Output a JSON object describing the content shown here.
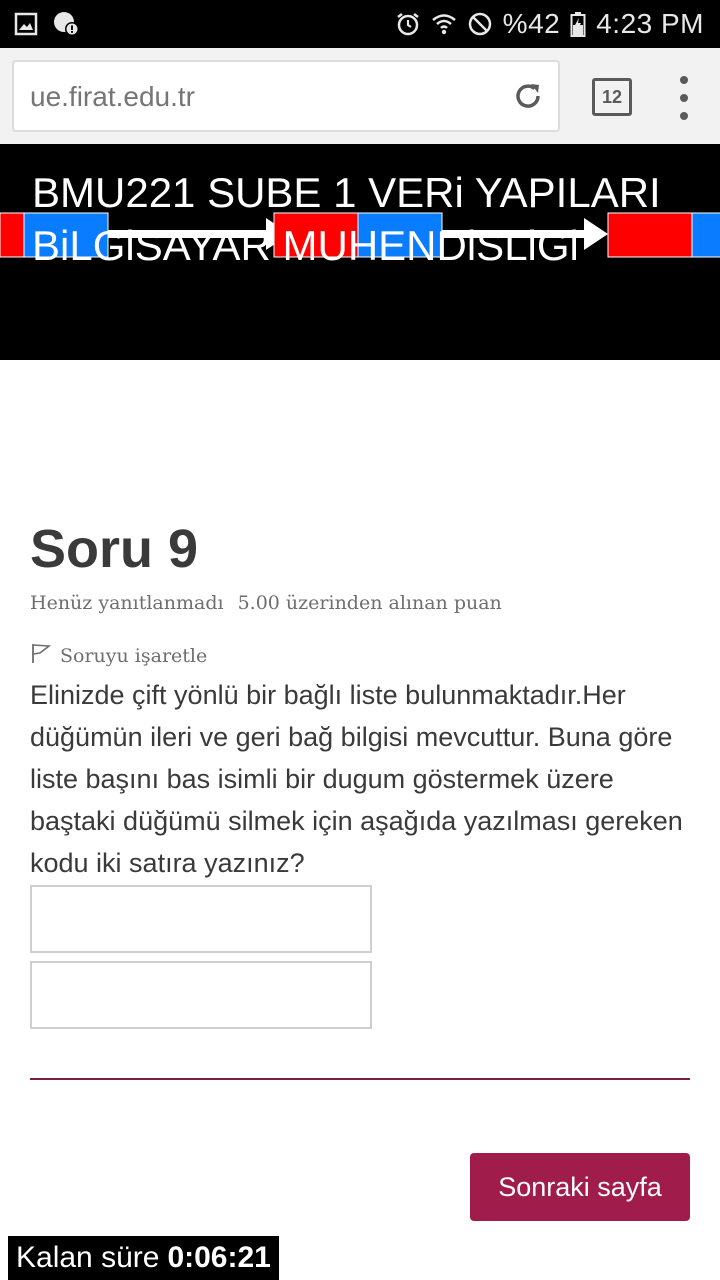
{
  "status_bar": {
    "battery": "%42",
    "time": "4:23 PM",
    "icons": [
      "gallery-icon",
      "location-alert-icon",
      "alarm-icon",
      "wifi-icon",
      "do-not-disturb-icon",
      "battery-icon"
    ]
  },
  "browser": {
    "url": "ue.firat.edu.tr",
    "tab_count": "12"
  },
  "banner": {
    "title": "BMU221 SUBE 1 VERi YAPILARI BiLGiSAYAR MUHENDiSLiGi",
    "colors": {
      "red": "#ff0000",
      "blue": "#0a7cff",
      "arrow": "#ffffff"
    }
  },
  "question": {
    "title": "Soru 9",
    "status": "Henüz yanıtlanmadı",
    "points": "5.00 üzerinden alınan puan",
    "flag_label": "Soruyu işaretle",
    "text": "Elinizde çift yönlü bir bağlı liste bulunmaktadır.Her düğümün ileri ve geri bağ bilgisi mevcuttur. Buna göre liste başını bas isimli bir dugum göstermek üzere baştaki düğümü silmek için aşağıda yazılması gereken kodu iki satıra yazınız?",
    "answers": [
      "",
      ""
    ]
  },
  "navigation": {
    "next_label": "Sonraki sayfa"
  },
  "timer": {
    "label": "Kalan süre",
    "value": "0:06:21"
  },
  "colors": {
    "accent": "#a01c4a",
    "divider": "#7b1e46"
  }
}
